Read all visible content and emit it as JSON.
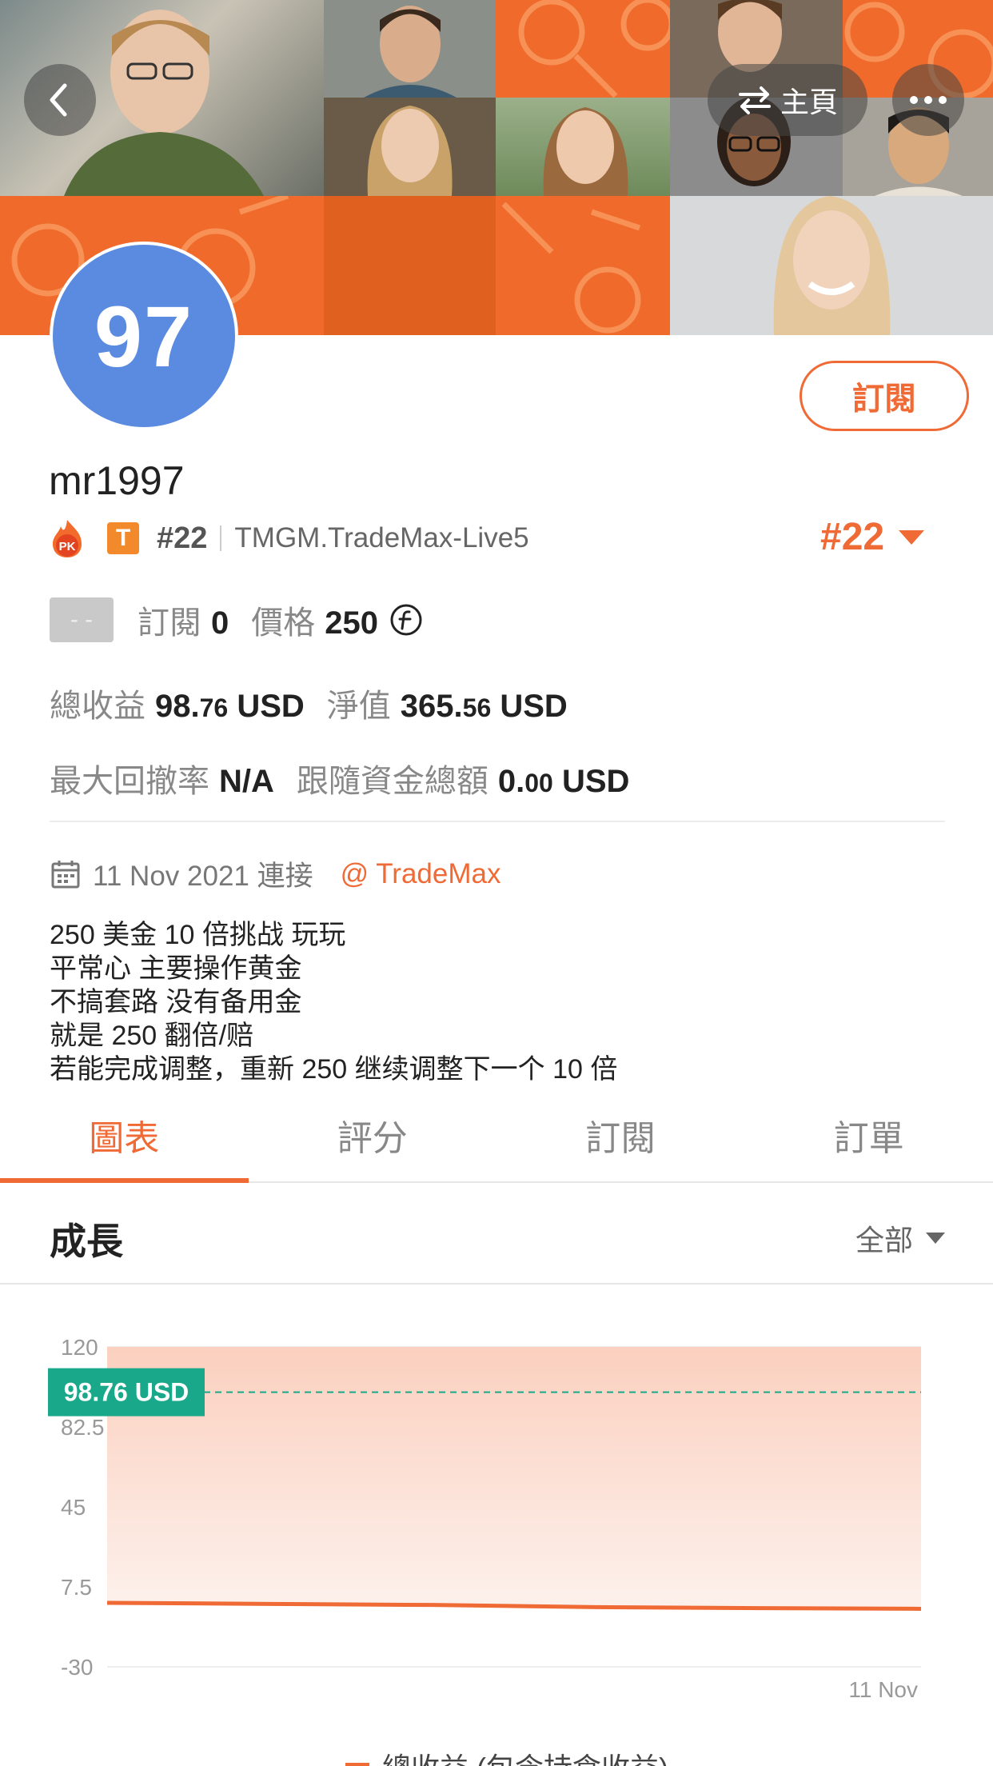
{
  "header": {
    "home_label": "主頁",
    "back_icon": "chevron-left-icon",
    "swap_icon": "swap-arrows-icon",
    "more_icon": "more-dots-icon"
  },
  "profile": {
    "avatar_text": "97",
    "avatar_color": "#5b8be0",
    "username": "mr1997",
    "subscribe_label": "訂閱",
    "pk_badge": "PK",
    "tier_badge": "T",
    "rank_small": "#22",
    "server": "TMGM.TradeMax-Live5",
    "rank_big": "#22"
  },
  "stats": {
    "status_placeholder": "- -",
    "subscribe_label": "訂閱",
    "subscribe_count": "0",
    "price_label": "價格",
    "price_value": "250",
    "total_profit_label": "總收益",
    "total_profit_int": "98.",
    "total_profit_dec": "76",
    "total_profit_unit": "USD",
    "equity_label": "淨值",
    "equity_int": "365.",
    "equity_dec": "56",
    "equity_unit": "USD",
    "max_drawdown_label": "最大回撤率",
    "max_drawdown_value": "N/A",
    "follow_funds_label": "跟隨資金總額",
    "follow_funds_int": "0.",
    "follow_funds_dec": "00",
    "follow_funds_unit": "USD"
  },
  "join": {
    "date_text": "11 Nov 2021 連接",
    "broker": "@ TradeMax"
  },
  "bio": {
    "lines": [
      "250 美金 10 倍挑战 玩玩",
      "平常心 主要操作黄金",
      "不搞套路 没有备用金",
      "就是 250 翻倍/赔",
      "若能完成调整，重新 250 继续调整下一个 10 倍"
    ]
  },
  "tabs": [
    "圖表",
    "評分",
    "訂閱",
    "訂單"
  ],
  "active_tab": 0,
  "section": {
    "title": "成長",
    "range_label": "全部"
  },
  "colors": {
    "accent": "#ef6a35",
    "teal": "#1aa88a",
    "fill": "#fbd3c3"
  },
  "chart_data": {
    "type": "area",
    "title": "",
    "y_ticks": [
      "120",
      "82.5",
      "45",
      "7.5",
      "-30"
    ],
    "ylim": [
      -30,
      120
    ],
    "x_tick": "11 Nov",
    "current_value_label": "98.76 USD",
    "current_value": 98.76,
    "series": [
      {
        "name": "總收益 (包含持倉收益)",
        "values": [
          0,
          -0.5,
          -1,
          -2,
          -2.5,
          -2.8
        ]
      }
    ],
    "band_top": 120
  },
  "legend_label": "總收益 (包含持倉收益)"
}
